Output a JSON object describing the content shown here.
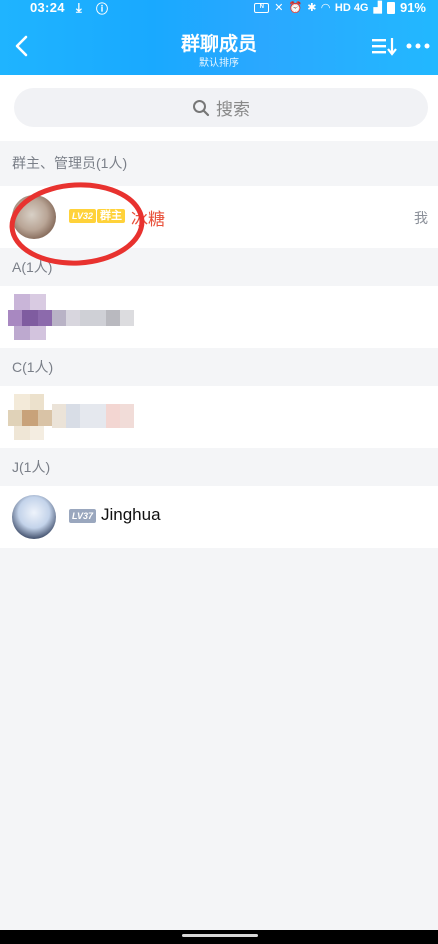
{
  "status_bar": {
    "time": "03:24",
    "network": "HD 4G",
    "battery": "91%"
  },
  "header": {
    "title": "群聊成员",
    "subtitle": "默认排序"
  },
  "search": {
    "placeholder": "搜索"
  },
  "sections": [
    {
      "label": "群主、管理员(1人)",
      "members": [
        {
          "level": "LV32",
          "role": "群主",
          "name": "冰糖",
          "tag": "我"
        }
      ]
    },
    {
      "label": "A(1人)",
      "members": [
        {
          "blurred": true
        }
      ]
    },
    {
      "label": "C(1人)",
      "members": [
        {
          "blurred": true
        }
      ]
    },
    {
      "label": "J(1人)",
      "members": [
        {
          "level": "LV37",
          "name": "Jinghua"
        }
      ]
    }
  ],
  "colors": {
    "header_blue": "#1fb4ff",
    "owner_badge": "#ffd23a",
    "owner_name": "#e8503a",
    "level_gray": "#9aa7be",
    "annotation_red": "#e8322f"
  }
}
